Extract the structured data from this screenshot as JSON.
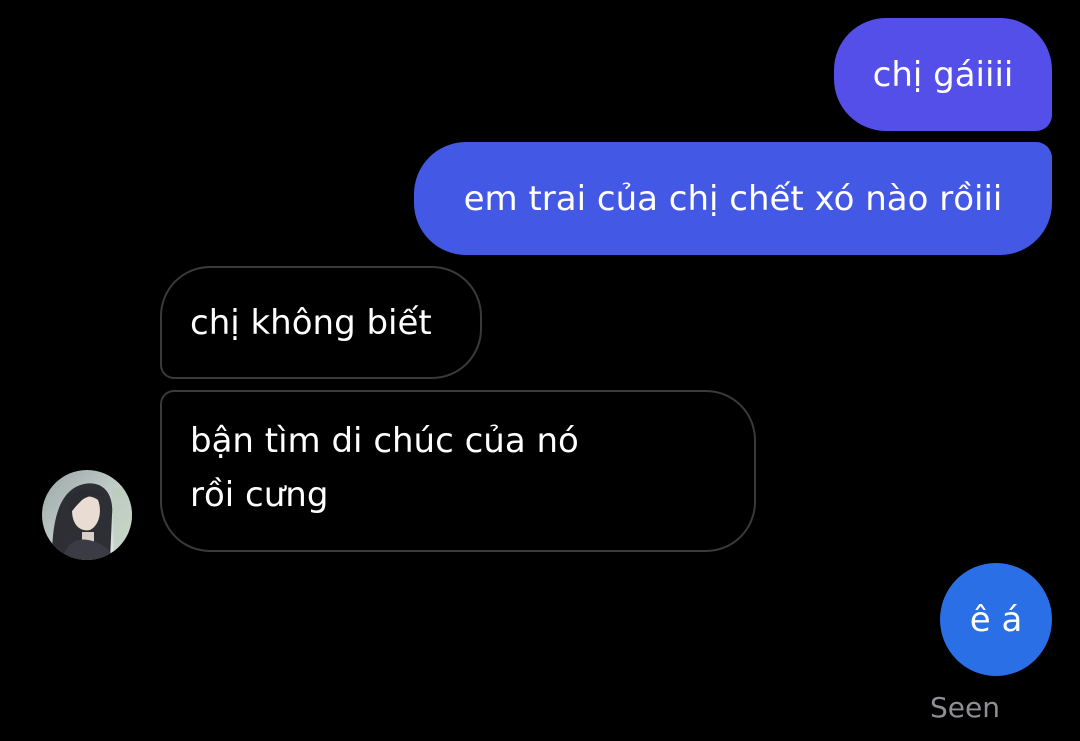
{
  "colors": {
    "background": "#000000",
    "outgoing_gradient_top": "#5b4fe8",
    "outgoing_mid": "#4058e6",
    "outgoing_bottom": "#2a6fe6",
    "incoming_border": "#3a3a3c",
    "text": "#ffffff",
    "seen_text": "#8e8e93"
  },
  "messages": [
    {
      "direction": "outgoing",
      "text": "chị gáiiii"
    },
    {
      "direction": "outgoing",
      "text": "em trai của chị chết xó nào rồiii"
    },
    {
      "direction": "incoming",
      "text": "chị không biết"
    },
    {
      "direction": "incoming",
      "text": "bận tìm di chúc của nó rồi cưng"
    },
    {
      "direction": "outgoing",
      "text": "ê á"
    }
  ],
  "contact": {
    "avatar_icon": "contact-avatar-photo"
  },
  "status": {
    "seen_label": "Seen"
  }
}
